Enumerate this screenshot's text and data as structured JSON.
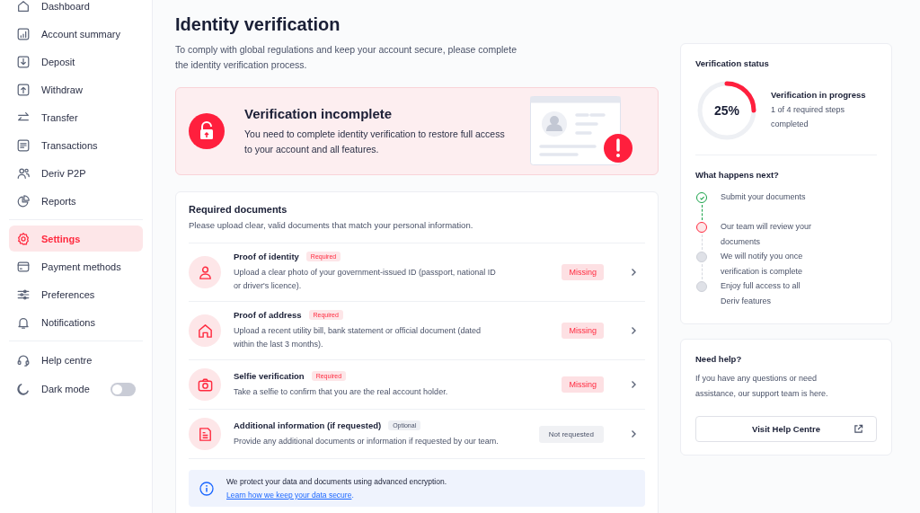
{
  "sidebar": {
    "groups": [
      {
        "items": [
          {
            "label": "Dashboard",
            "kind": "home",
            "selected": false
          },
          {
            "label": "Account summary",
            "kind": "chart",
            "selected": false
          },
          {
            "label": "Deposit",
            "kind": "down",
            "selected": false
          },
          {
            "label": "Withdraw",
            "kind": "up",
            "selected": false
          },
          {
            "label": "Transfer",
            "kind": "transfer",
            "selected": false
          },
          {
            "label": "Transactions",
            "kind": "list",
            "selected": false
          },
          {
            "label": "Deriv P2P",
            "kind": "people",
            "selected": false
          },
          {
            "label": "Reports",
            "kind": "pie",
            "selected": false
          }
        ]
      },
      {
        "items": [
          {
            "label": "Settings",
            "kind": "gear",
            "selected": true
          },
          {
            "label": "Payment methods",
            "kind": "card",
            "selected": false
          },
          {
            "label": "Preferences",
            "kind": "sliders",
            "selected": false
          },
          {
            "label": "Notifications",
            "kind": "bell",
            "selected": false
          }
        ]
      },
      {
        "items": [
          {
            "label": "Help centre",
            "kind": "headset",
            "selected": false
          }
        ]
      }
    ],
    "dark_mode": {
      "label": "Dark mode",
      "on": false
    }
  },
  "page": {
    "title": "Identity verification",
    "subtitle": "To comply with global regulations and keep your account secure, please complete the identity verification process."
  },
  "banner": {
    "title": "Verification incomplete",
    "text": "You need to complete identity verification to restore full access to your account and all features."
  },
  "documents": {
    "title": "Required documents",
    "subtitle": "Please upload clear, valid documents that match your personal information.",
    "items": [
      {
        "kind": "person",
        "title": "Proof of identity",
        "tag": "Required",
        "required": true,
        "description": "Upload a clear photo of your government-issued ID (passport, national ID or driver's licence).",
        "status": "Missing",
        "missing": true
      },
      {
        "kind": "house",
        "title": "Proof of address",
        "tag": "Required",
        "required": true,
        "description": "Upload a recent utility bill, bank statement or official document (dated within the last 3 months).",
        "status": "Missing",
        "missing": true
      },
      {
        "kind": "camera",
        "title": "Selfie verification",
        "tag": "Required",
        "required": true,
        "description": "Take a selfie to confirm that you are the real account holder.",
        "status": "Missing",
        "missing": true
      },
      {
        "kind": "document",
        "title": "Additional information (if requested)",
        "tag": "Optional",
        "required": false,
        "description": "Provide any additional documents or information if requested by our team.",
        "status": "Not requested",
        "missing": false
      }
    ],
    "notice": {
      "text": "We protect your data and documents using advanced encryption.",
      "link": "Learn how we keep your data secure",
      "after": "."
    }
  },
  "status": {
    "title": "Verification status",
    "percent": "25%",
    "level": 0.25,
    "heading": "Verification in progress",
    "detail": "1 of 4 required steps completed",
    "next_title": "What happens next?",
    "steps": [
      {
        "label": "Submit your documents",
        "kind": "done"
      },
      {
        "label": "Our team will review your documents",
        "kind": "current"
      },
      {
        "label": "We will notify you once verification is complete",
        "kind": "pending"
      },
      {
        "label": "Enjoy full access to all Deriv features",
        "kind": "pending"
      }
    ]
  },
  "help": {
    "title": "Need help?",
    "text": "If you have any questions or need assistance, our support team is here.",
    "button": "Visit Help Centre"
  }
}
